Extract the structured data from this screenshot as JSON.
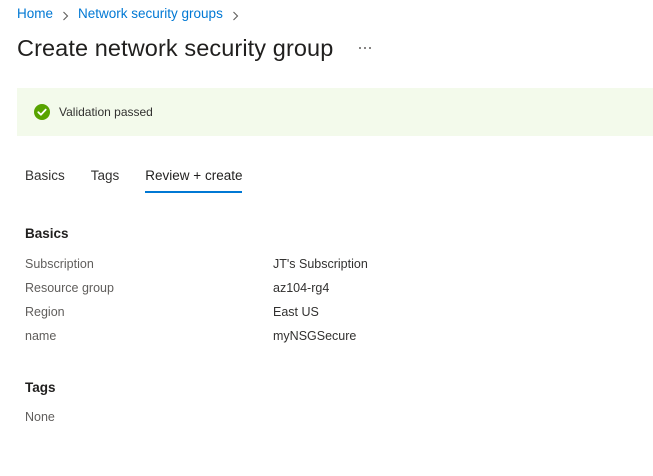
{
  "breadcrumb": {
    "items": [
      "Home",
      "Network security groups"
    ]
  },
  "header": {
    "title": "Create network security group",
    "more_icon": "ellipsis-icon"
  },
  "validation": {
    "text": "Validation passed",
    "icon": "check-circle-icon",
    "color": "#57a300",
    "background": "#f3faeb"
  },
  "tabs": [
    {
      "label": "Basics",
      "active": false
    },
    {
      "label": "Tags",
      "active": false
    },
    {
      "label": "Review + create",
      "active": true
    }
  ],
  "basics": {
    "heading": "Basics",
    "rows": [
      {
        "label": "Subscription",
        "value": "JT's Subscription"
      },
      {
        "label": "Resource group",
        "value": "az104-rg4"
      },
      {
        "label": "Region",
        "value": "East US"
      },
      {
        "label": "name",
        "value": "myNSGSecure"
      }
    ]
  },
  "tags": {
    "heading": "Tags",
    "value": "None"
  },
  "colors": {
    "accent": "#0078d4",
    "success": "#57a300"
  }
}
